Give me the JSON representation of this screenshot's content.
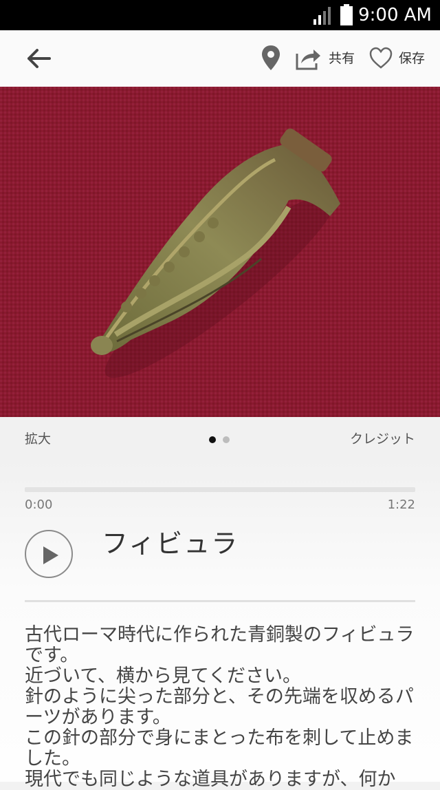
{
  "status_bar": {
    "time": "9:00 AM"
  },
  "app_bar": {
    "back_icon": "arrow-left-icon",
    "location_icon": "map-pin-icon",
    "share_icon": "share-icon",
    "share_label": "共有",
    "save_icon": "heart-icon",
    "save_label": "保存"
  },
  "hero_image": {
    "subject": "fibula-artifact",
    "background_color": "#8c1a30"
  },
  "gallery": {
    "zoom_label": "拡大",
    "credit_label": "クレジット",
    "page_count": 2,
    "current_page": 1
  },
  "audio": {
    "start_time": "0:00",
    "end_time": "1:22",
    "progress": 0,
    "play_icon": "play-icon"
  },
  "title": "フィビュラ",
  "description": [
    "古代ローマ時代に作られた青銅製のフィビュラです。",
    "近づいて、横から見てください。",
    "針のように尖った部分と、その先端を収めるパーツがあります。",
    "この針の部分で身にまとった布を刺して止めました。",
    "現代でも同じような道具がありますが、何か"
  ],
  "colors": {
    "accent": "#8c1a30",
    "status_bar": "#000000",
    "text_primary": "#333333"
  }
}
